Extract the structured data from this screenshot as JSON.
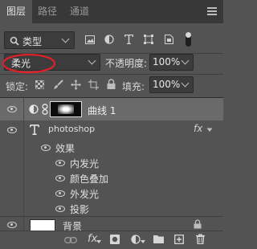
{
  "tabs": [
    {
      "label": "图层"
    },
    {
      "label": "路径"
    },
    {
      "label": "通道"
    }
  ],
  "filter": {
    "kind_label": "类型"
  },
  "blend": {
    "mode": "柔光",
    "opacity_label": "不透明度:",
    "opacity_value": "100%"
  },
  "lock": {
    "label": "锁定:",
    "fill_label": "填充:",
    "fill_value": "100%"
  },
  "layers": {
    "curves": {
      "name": "曲线 1"
    },
    "text": {
      "name": "photoshop",
      "fx": "fx"
    },
    "effects": {
      "label": "效果",
      "items": [
        "内发光",
        "颜色叠加",
        "外发光",
        "投影"
      ]
    },
    "background": {
      "name": "背景"
    }
  },
  "bottom": {
    "fx": "fx"
  },
  "colors": {
    "panel": "#535353",
    "tabbar": "#383838",
    "annotation": "#e0202a",
    "selected_row": "#6a6a6a"
  }
}
